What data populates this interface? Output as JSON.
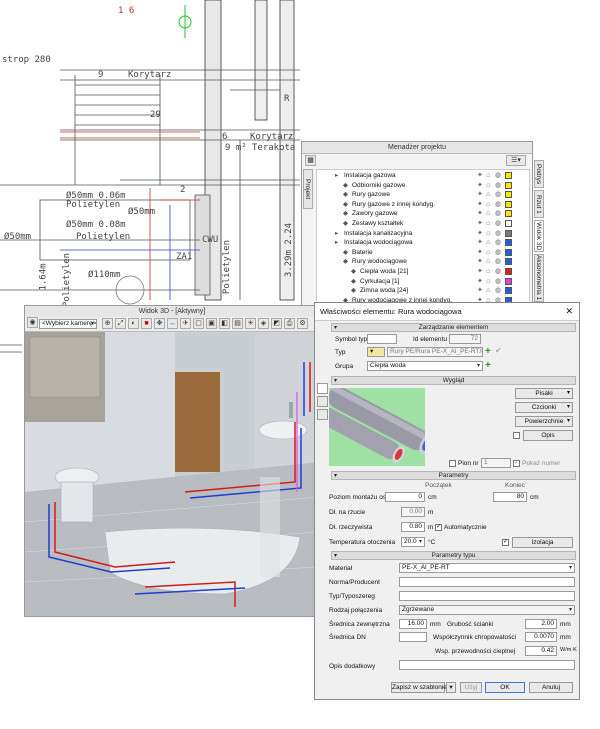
{
  "cad": {
    "texts": [
      {
        "t": "strop 280",
        "cls": ""
      },
      {
        "t": "1 6",
        "cls": "cadred"
      },
      {
        "t": "9",
        "cls": ""
      },
      {
        "t": "Korytarz",
        "cls": ""
      },
      {
        "t": "6",
        "cls": ""
      },
      {
        "t": "Korytarz",
        "cls": ""
      },
      {
        "t": "9 m²",
        "cls": ""
      },
      {
        "t": "Terakota",
        "cls": ""
      },
      {
        "t": "R",
        "cls": ""
      },
      {
        "t": "29",
        "cls": ""
      },
      {
        "t": "2",
        "cls": ""
      },
      {
        "t": "Ø50mm 0.06m",
        "cls": ""
      },
      {
        "t": "Polietylen",
        "cls": ""
      },
      {
        "t": "Ø50mm",
        "cls": ""
      },
      {
        "t": "Ø50mm 0.08m",
        "cls": ""
      },
      {
        "t": "Polietylen",
        "cls": ""
      },
      {
        "t": "Ø50mm",
        "cls": ""
      },
      {
        "t": "Ø110mm",
        "cls": ""
      },
      {
        "t": "CWU",
        "cls": ""
      },
      {
        "t": "ZA1",
        "cls": ""
      },
      {
        "t": "Polietylen",
        "cls": ""
      },
      {
        "t": "1.64m",
        "cls": ""
      },
      {
        "t": "3.29m 2.24",
        "cls": ""
      },
      {
        "t": "Polietylen",
        "cls": ""
      }
    ]
  },
  "manager": {
    "title": "Menadżer projektu",
    "left_tab": "Projekt",
    "right_tabs": [
      "Podrys",
      "Rzut 1",
      "Widok 3D",
      "Aksonometria 1"
    ],
    "items": [
      {
        "label": "Instalacja gazowa",
        "color": "#f7e600"
      },
      {
        "label": "Odbiorniki gazowe",
        "color": "#f7e600"
      },
      {
        "label": "Rury gazowe",
        "color": "#f7e600"
      },
      {
        "label": "Rury gazowe z innej kondyg.",
        "color": "#f7e600"
      },
      {
        "label": "Zawory gazowe",
        "color": "#f7e600"
      },
      {
        "label": "Zestawy kształtek",
        "color": "#ffffff"
      },
      {
        "label": "Instalacja kanalizacyjna",
        "color": "#7a7a7a"
      },
      {
        "label": "Instalacja wodociągowa",
        "color": "#2060e0"
      },
      {
        "label": "Baterie",
        "color": "#2060e0"
      },
      {
        "label": "Rury wodociągowe",
        "color": "#2060e0"
      },
      {
        "label": "Ciepła woda [21]",
        "color": "#e02020"
      },
      {
        "label": "Cyrkulacja [1]",
        "color": "#e040e0"
      },
      {
        "label": "Zimna woda [24]",
        "color": "#2060e0"
      },
      {
        "label": "Rury wodociągowe z innej kondyg.",
        "color": "#2060e0"
      }
    ]
  },
  "view3d": {
    "title": "Widok 3D - [Aktywny]",
    "camera": "<Wybierz kamerę>"
  },
  "dialog": {
    "title": "Właściwości elementu: Rura wodociągowa",
    "close": "✕",
    "sections": {
      "manage": "Zarządzanie elementem",
      "appearance": "Wygląd",
      "params": "Parametry",
      "type_params": "Parametry typu"
    },
    "manage": {
      "symbol_label": "Symbol typu",
      "symbol_value": "",
      "id_label": "Id elementu",
      "id_value": "72",
      "type_label": "Typ",
      "type_value": "Rury PE/Rura PE-X_Al_PE-RT/Dn",
      "group_label": "Grupa",
      "group_value": "Ciepła woda"
    },
    "appearance": {
      "pens": "Pisaki",
      "fonts": "Czcionki",
      "surfaces": "Powierzchnie",
      "desc": "Opis",
      "level_no_label": "Pion nr",
      "level_no_value": "1",
      "show_number": "Pokaż numer"
    },
    "params": {
      "start": "Początek",
      "end": "Koniec",
      "axis_height_label": "Poziom montażu osi",
      "axis_start": "0",
      "axis_start_unit": "cm",
      "axis_end": "80",
      "axis_end_unit": "cm",
      "proj_len_label": "Dł. na rzucie",
      "proj_len": "0.00",
      "proj_len_unit": "m",
      "real_len_label": "Dł. rzeczywista",
      "real_len": "0.80",
      "real_len_unit": "m",
      "auto_label": "Automatycznie",
      "temp_label": "Temperatura otoczenia",
      "temp_value": "20.0",
      "temp_unit": "°C",
      "insulation": "Izolacja"
    },
    "type_params": {
      "material_label": "Materiał",
      "material_value": "PE-X_Al_PE-RT",
      "producer_label": "Norma/Producent",
      "producer_value": "",
      "typesize_label": "Typ/Typoszereg",
      "typesize_value": "",
      "conn_label": "Rodzaj połączenia",
      "conn_value": "Zgrzewane",
      "ext_d_label": "Średnica zewnętrzna",
      "ext_d_value": "16.00",
      "ext_d_unit": "mm",
      "wall_label": "Grubość ścianki",
      "wall_value": "2.00",
      "wall_unit": "mm",
      "dn_label": "Średnica DN",
      "dn_value": "",
      "rough_label": "Współczynnik chropowatości",
      "rough_value": "0.0070",
      "rough_unit": "mm",
      "cond_label": "Wsp. przewodności cieplnej",
      "cond_value": "0.42",
      "cond_unit": "W/m·K",
      "extra_label": "Opis dodatkowy",
      "extra_value": ""
    },
    "buttons": {
      "save_template": "Zapisz w szablonie",
      "apply": "Użyj",
      "ok": "OK",
      "cancel": "Anuluj"
    }
  }
}
